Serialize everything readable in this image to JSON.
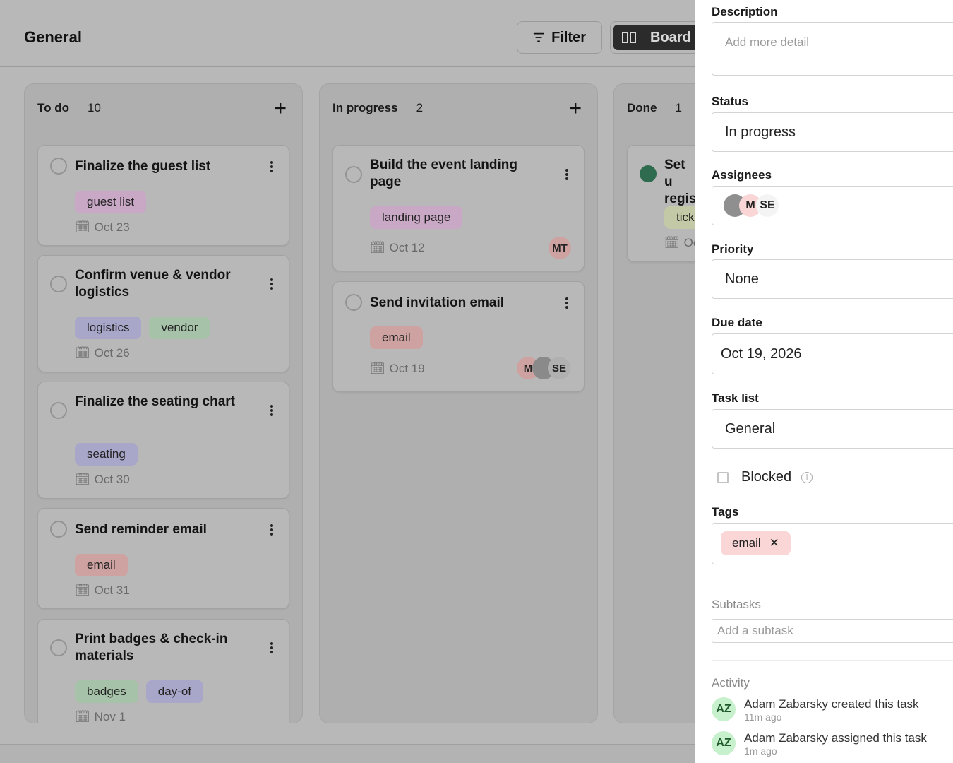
{
  "header": {
    "title": "General",
    "filter_label": "Filter",
    "board_label": "Board"
  },
  "columns": [
    {
      "name": "To do",
      "count": "10",
      "cards": [
        {
          "title": "Finalize the guest list",
          "tags": [
            "guest list"
          ],
          "due": "Oct 23"
        },
        {
          "title": "Confirm venue & vendor logistics",
          "tags": [
            "logistics",
            "vendor"
          ],
          "due": "Oct 26"
        },
        {
          "title": "Finalize the seating chart",
          "tags": [
            "seating"
          ],
          "due": "Oct 30"
        },
        {
          "title": "Send reminder email",
          "tags": [
            "email"
          ],
          "due": "Oct 31"
        },
        {
          "title": "Print badges & check-in materials",
          "tags": [
            "badges",
            "day-of"
          ],
          "due": "Nov 1"
        }
      ]
    },
    {
      "name": "In progress",
      "count": "2",
      "cards": [
        {
          "title": "Build the event landing page",
          "tags": [
            "landing page"
          ],
          "due": "Oct 12",
          "assignee": "MT"
        },
        {
          "title": "Send invitation email",
          "tags": [
            "email"
          ],
          "due": "Oct 19",
          "assignees": [
            "M",
            "",
            "SE"
          ]
        }
      ]
    },
    {
      "name": "Done",
      "count": "1",
      "cards": [
        {
          "title": "Set u regis",
          "tags": [
            "tick"
          ],
          "due": "Oc"
        }
      ]
    }
  ],
  "panel": {
    "description_label": "Description",
    "description_placeholder": "Add more detail",
    "status_label": "Status",
    "status_value": "In progress",
    "assignees_label": "Assignees",
    "assignee_initials": [
      "M",
      "SE"
    ],
    "priority_label": "Priority",
    "priority_value": "None",
    "due_label": "Due date",
    "due_value": "Oct 19, 2026",
    "tasklist_label": "Task list",
    "tasklist_value": "General",
    "blocked_label": "Blocked",
    "tags_label": "Tags",
    "tag_value": "email",
    "subtasks_label": "Subtasks",
    "subtask_placeholder": "Add a subtask",
    "activity_label": "Activity",
    "activity": [
      {
        "initials": "AZ",
        "text": "Adam Zabarsky created this task",
        "time": "11m ago"
      },
      {
        "initials": "AZ",
        "text": "Adam Zabarsky assigned this task",
        "time": "1m ago"
      }
    ]
  },
  "colors": {
    "tag_guest_list": "#c9a8c6",
    "tag_logistics": "#a8a6c9",
    "tag_vendor": "#a6c2a8",
    "tag_seating": "#a8a6c9",
    "tag_email": "#cfa2a2",
    "tag_badges": "#a6c2a8",
    "tag_dayof": "#a8a6c9",
    "tag_landing": "#c9a8c6",
    "panel_tag": "#fad6d6",
    "done_check": "#2f6b4e",
    "activity_avatar": "#c7f0cc"
  }
}
